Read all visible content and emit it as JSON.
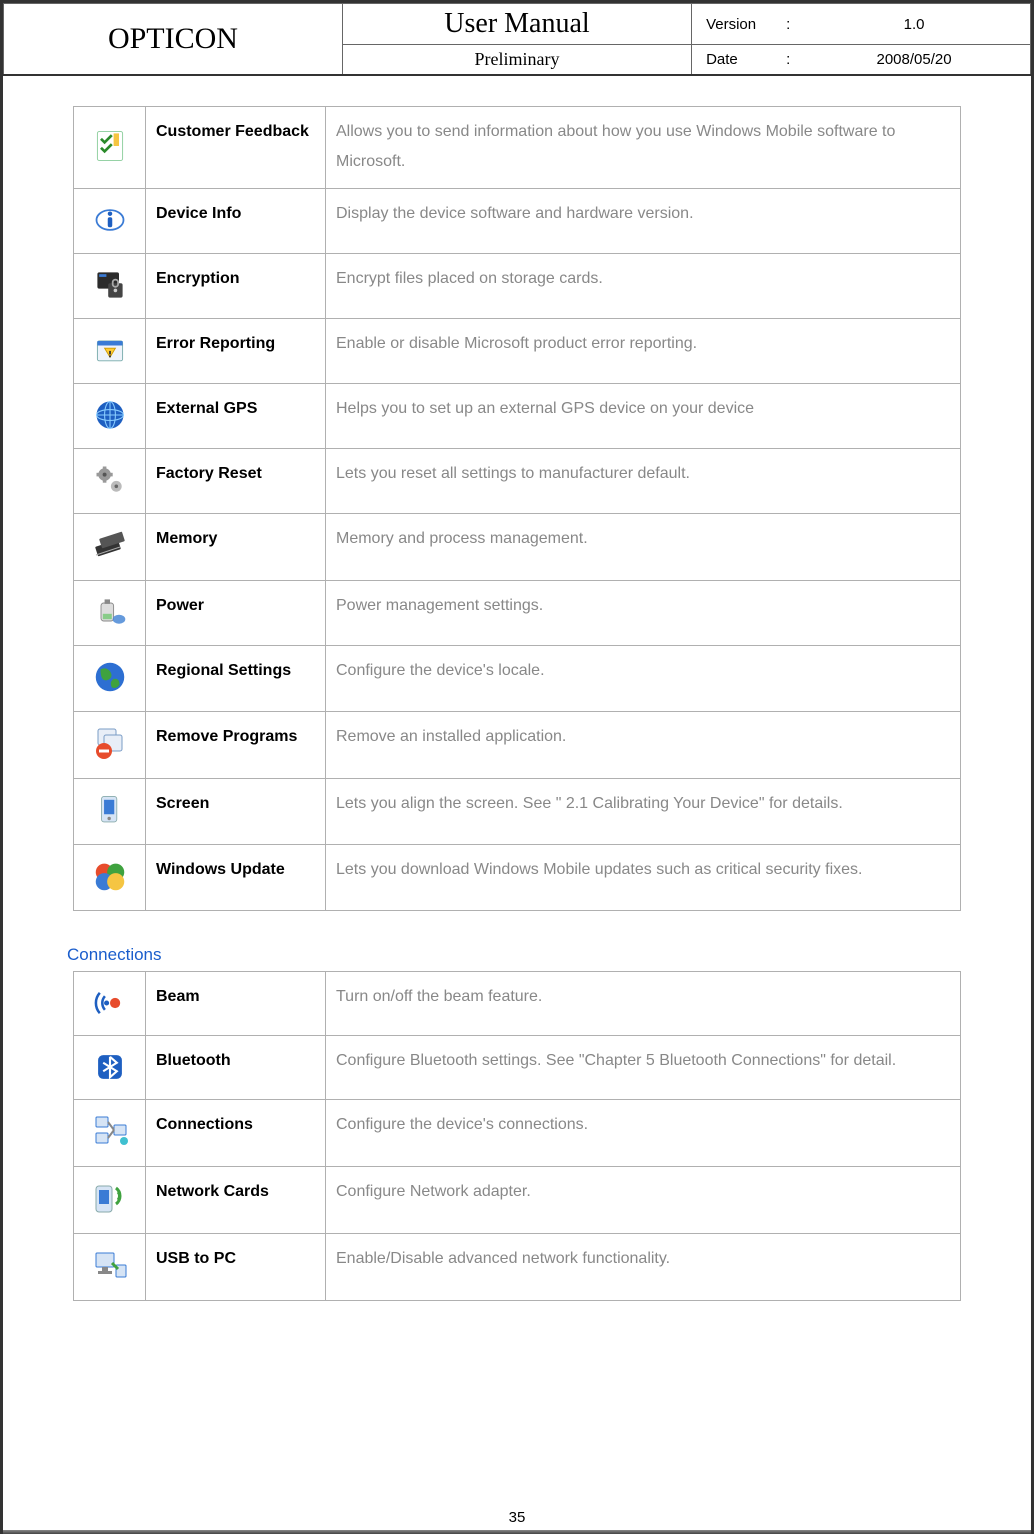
{
  "header": {
    "brand": "OPTICON",
    "title": "User Manual",
    "subtitle": "Preliminary",
    "version_label": "Version",
    "version_value": "1.0",
    "date_label": "Date",
    "date_value": "2008/05/20"
  },
  "settings_section": {
    "rows": [
      {
        "icon": "customer-feedback-icon",
        "label": "Customer Feedback",
        "desc": "Allows you to send information about how you use Windows Mobile software to Microsoft."
      },
      {
        "icon": "device-info-icon",
        "label": "Device Info",
        "desc": "Display the device software and hardware version."
      },
      {
        "icon": "encryption-icon",
        "label": "Encryption",
        "desc": "Encrypt files placed on storage cards."
      },
      {
        "icon": "error-reporting-icon",
        "label": "Error Reporting",
        "desc": "Enable or disable Microsoft product error reporting."
      },
      {
        "icon": "external-gps-icon",
        "label": "External GPS",
        "desc": "Helps you to set up an external GPS device on your device"
      },
      {
        "icon": "factory-reset-icon",
        "label": "Factory Reset",
        "desc": "Lets you reset all settings to manufacturer default."
      },
      {
        "icon": "memory-icon",
        "label": "Memory",
        "desc": "Memory and process management."
      },
      {
        "icon": "power-icon",
        "label": "Power",
        "desc": "Power management settings."
      },
      {
        "icon": "regional-settings-icon",
        "label": "Regional Settings",
        "desc": "Configure the device's locale."
      },
      {
        "icon": "remove-programs-icon",
        "label": "Remove Programs",
        "desc": "Remove an installed application."
      },
      {
        "icon": "screen-icon",
        "label": "Screen",
        "desc": "Lets you align the screen. See \" 2.1 Calibrating Your Device\" for details."
      },
      {
        "icon": "windows-update-icon",
        "label": "Windows Update",
        "desc": "Lets you download Windows Mobile updates such as critical security fixes."
      }
    ]
  },
  "connections_section": {
    "heading": "Connections",
    "rows": [
      {
        "icon": "beam-icon",
        "label": "Beam",
        "desc": "Turn on/off the beam feature."
      },
      {
        "icon": "bluetooth-icon",
        "label": "Bluetooth",
        "desc": "Configure Bluetooth settings. See \"Chapter 5 Bluetooth Connections\" for detail."
      },
      {
        "icon": "connections-icon",
        "label": "Connections",
        "desc": "Configure the device's connections."
      },
      {
        "icon": "network-cards-icon",
        "label": "Network Cards",
        "desc": "Configure Network adapter."
      },
      {
        "icon": "usb-to-pc-icon",
        "label": "USB to PC",
        "desc": "Enable/Disable advanced network functionality."
      }
    ]
  },
  "page_number": "35"
}
